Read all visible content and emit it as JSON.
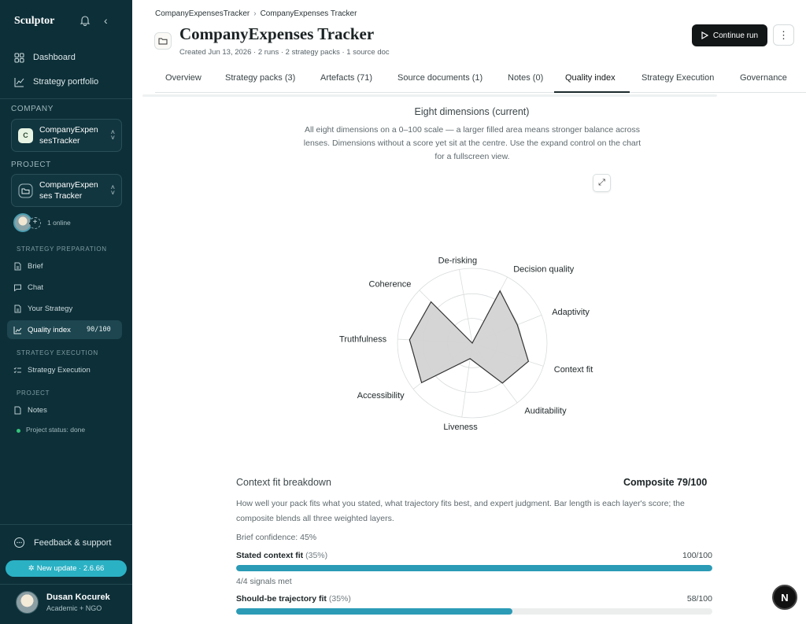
{
  "sidebar": {
    "brand": "Sculptor",
    "nav": [
      {
        "label": "Dashboard",
        "icon": "dashboard-icon"
      },
      {
        "label": "Strategy portfolio",
        "icon": "chart-icon"
      }
    ],
    "company_section": "COMPANY",
    "company_name": "CompanyExpensesTracker",
    "company_badge": "C",
    "project_section": "PROJECT",
    "project_name": "CompanyExpenses Tracker",
    "online_label": "1 online",
    "prep_section": "STRATEGY PREPARATION",
    "prep_items": [
      {
        "label": "Brief",
        "icon": "document-icon"
      },
      {
        "label": "Chat",
        "icon": "chat-icon"
      },
      {
        "label": "Your Strategy",
        "icon": "document-icon"
      },
      {
        "label": "Quality index",
        "icon": "line-chart-icon",
        "value": "90/100",
        "active": true
      }
    ],
    "exec_section": "STRATEGY EXECUTION",
    "exec_items": [
      {
        "label": "Strategy Execution",
        "icon": "checklist-icon"
      }
    ],
    "project_sub_section": "PROJECT",
    "project_items": [
      {
        "label": "Notes",
        "icon": "note-icon"
      }
    ],
    "project_status": "Project status: done",
    "status_color": "#34c47a",
    "feedback_label": "Feedback & support",
    "update_label": "New update · 2.6.66",
    "user": {
      "name": "Dusan Kocurek",
      "role": "Academic + NGO"
    }
  },
  "header": {
    "breadcrumb": [
      "CompanyExpensesTracker",
      "CompanyExpenses Tracker"
    ],
    "breadcrumb_sep": "›",
    "title": "CompanyExpenses Tracker",
    "meta": "Created Jun 13, 2026 · 2 runs · 2 strategy packs · 1 source doc",
    "continue_label": "Continue run",
    "more_label": "⋮"
  },
  "tabs": [
    {
      "label": "Overview"
    },
    {
      "label": "Strategy packs (3)"
    },
    {
      "label": "Artefacts (71)"
    },
    {
      "label": "Source documents (1)"
    },
    {
      "label": "Notes (0)"
    },
    {
      "label": "Quality index",
      "active": true
    },
    {
      "label": "Strategy Execution"
    },
    {
      "label": "Governance"
    }
  ],
  "radar_section": {
    "title": "Eight dimensions (current)",
    "description": "All eight dimensions on a 0–100 scale — a larger filled area means stronger balance across lenses. Dimensions without a score yet sit at the centre. Use the expand control on the chart for a fullscreen view.",
    "expand_icon": "⤢"
  },
  "chart_data": {
    "type": "radar",
    "scale": [
      0,
      100
    ],
    "axes": [
      "De-risking",
      "Decision quality",
      "Adaptivity",
      "Context fit",
      "Auditability",
      "Liveness",
      "Accessibility",
      "Truthfulness",
      "Coherence"
    ],
    "values": [
      0,
      79,
      65,
      79,
      67,
      21,
      86,
      84,
      78
    ],
    "fill_color": "#d3d3d3",
    "stroke_color": "#333333"
  },
  "breakdown": {
    "title": "Context fit breakdown",
    "composite": "Composite 79/100",
    "description": "How well your pack fits what you stated, what trajectory fits best, and expert judgment. Bar length is each layer's score; the composite blends all three weighted layers.",
    "brief_confidence": "Brief confidence: 45%",
    "rows": [
      {
        "label": "Stated context fit",
        "weight": "(35%)",
        "value_text": "100/100",
        "value": 100,
        "note": "4/4 signals met"
      },
      {
        "label": "Should-be trajectory fit",
        "weight": "(35%)",
        "value_text": "58/100",
        "value": 58
      }
    ],
    "bar_color": "#2b9bb6"
  },
  "fab_label": "N"
}
